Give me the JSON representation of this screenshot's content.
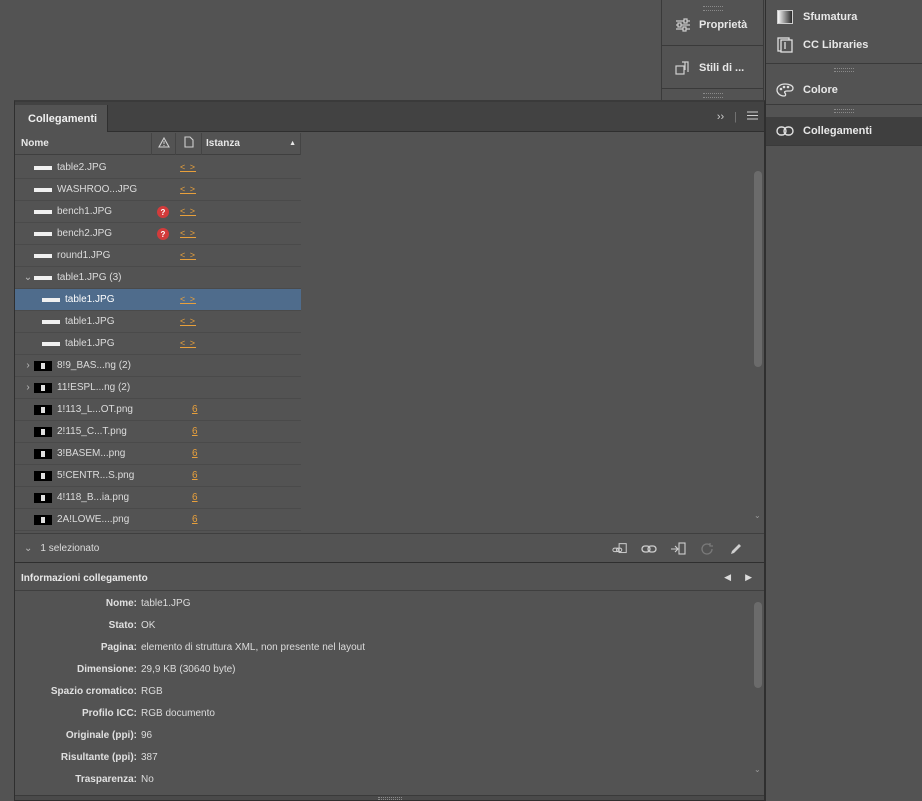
{
  "dock_left": [
    {
      "label": "Proprietà",
      "icon": "sliders-icon"
    },
    {
      "label": "Stili di ...",
      "icon": "paragraph-style-icon"
    }
  ],
  "dock_right": [
    {
      "label": "Sfumatura",
      "icon": "gradient-icon"
    },
    {
      "label": "CC Libraries",
      "icon": "cc-libraries-icon"
    },
    {
      "label": "Colore",
      "icon": "palette-icon"
    },
    {
      "label": "Collegamenti",
      "icon": "links-icon"
    }
  ],
  "panel": {
    "tab_label": "Collegamenti",
    "columns": {
      "name": "Nome",
      "instance": "Istanza"
    },
    "rows": [
      {
        "name": "table2.JPG",
        "inst": "< >",
        "thumb": "bar"
      },
      {
        "name": "WASHROO...JPG",
        "inst": "< >",
        "thumb": "bar"
      },
      {
        "name": "bench1.JPG",
        "inst": "< >",
        "warn": "?",
        "thumb": "bar"
      },
      {
        "name": "bench2.JPG",
        "inst": "< >",
        "warn": "?",
        "thumb": "bar"
      },
      {
        "name": "round1.JPG",
        "inst": "< >",
        "thumb": "bar"
      },
      {
        "name": "table1.JPG (3)",
        "thumb": "bar",
        "expander": "⌄"
      },
      {
        "name": "table1.JPG",
        "inst": "< >",
        "thumb": "bar",
        "child": true,
        "selected": true
      },
      {
        "name": "table1.JPG",
        "inst": "< >",
        "thumb": "bar",
        "child": true
      },
      {
        "name": "table1.JPG",
        "inst": "< >",
        "thumb": "bar",
        "child": true
      },
      {
        "name": "8!9_BAS...ng (2)",
        "thumb": "black",
        "expander": "›"
      },
      {
        "name": "11!ESPL...ng (2)",
        "thumb": "black",
        "expander": "›"
      },
      {
        "name": "1!113_L...OT.png",
        "inst": "6",
        "thumb": "black"
      },
      {
        "name": "2!115_C...T.png",
        "inst": "6",
        "thumb": "black"
      },
      {
        "name": "3!BASEM...png",
        "inst": "6",
        "thumb": "black"
      },
      {
        "name": "5!CENTR...S.png",
        "inst": "6",
        "thumb": "black"
      },
      {
        "name": "4!118_B...ia.png",
        "inst": "6",
        "thumb": "black"
      },
      {
        "name": "2A!LOWE....png",
        "inst": "6",
        "thumb": "black"
      }
    ],
    "selection_count": "1 selezionato",
    "info_title": "Informazioni collegamento",
    "info": [
      {
        "k": "Nome:",
        "v": "table1.JPG"
      },
      {
        "k": "Stato:",
        "v": "OK"
      },
      {
        "k": "Pagina:",
        "v": "elemento di struttura XML, non presente nel layout"
      },
      {
        "k": "Dimensione:",
        "v": "29,9 KB (30640 byte)"
      },
      {
        "k": "Spazio cromatico:",
        "v": "RGB"
      },
      {
        "k": "Profilo ICC:",
        "v": "RGB documento"
      },
      {
        "k": "Originale (ppi):",
        "v": "96"
      },
      {
        "k": "Risultante (ppi):",
        "v": "387"
      },
      {
        "k": "Trasparenza:",
        "v": "No"
      }
    ]
  }
}
